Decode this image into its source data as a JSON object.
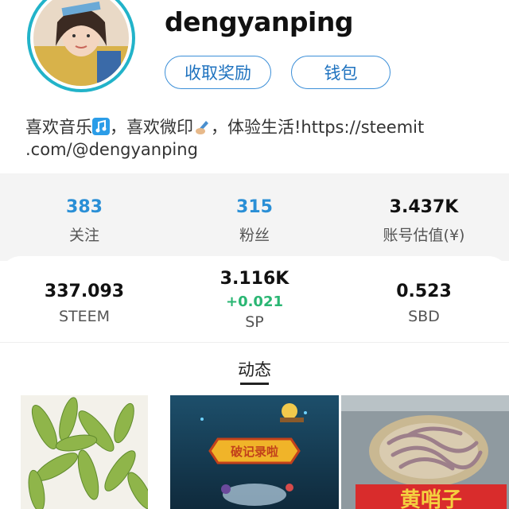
{
  "profile": {
    "username": "dengyanping",
    "avatar_icon": "avatar-photo",
    "ring_color": "#22b3c9"
  },
  "buttons": {
    "rewards_label": "收取奖励",
    "wallet_label": "钱包"
  },
  "bio": {
    "part1": "喜欢音乐",
    "emoji1": "music-note-icon",
    "part2": "，喜欢微印",
    "emoji2": "writing-hand-icon",
    "part3": "，体验生活!https://steemit",
    "part4": ".com/@dengyanping"
  },
  "stats": {
    "following": {
      "value": "383",
      "label": "关注"
    },
    "followers": {
      "value": "315",
      "label": "粉丝"
    },
    "account_value": {
      "value": "3.437K",
      "label": "账号估值(¥)"
    }
  },
  "wallet": {
    "steem": {
      "value": "337.093",
      "label": "STEEM"
    },
    "sp": {
      "value": "3.116K",
      "delta": "+0.021",
      "label": "SP"
    },
    "sbd": {
      "value": "0.523",
      "label": "SBD"
    }
  },
  "tabs": {
    "active_label": "动态"
  },
  "posts": [
    {
      "image": "edamame-photo"
    },
    {
      "image": "game-record-photo",
      "banner_text": "破记录啦"
    },
    {
      "image": "market-seafood-photo",
      "sign_text": "黄哨子"
    }
  ],
  "colors": {
    "accent_blue": "#2a8fd6",
    "button_border": "#3c8fd8",
    "delta_green": "#2ab673",
    "stats_bg": "#f4f4f4"
  }
}
